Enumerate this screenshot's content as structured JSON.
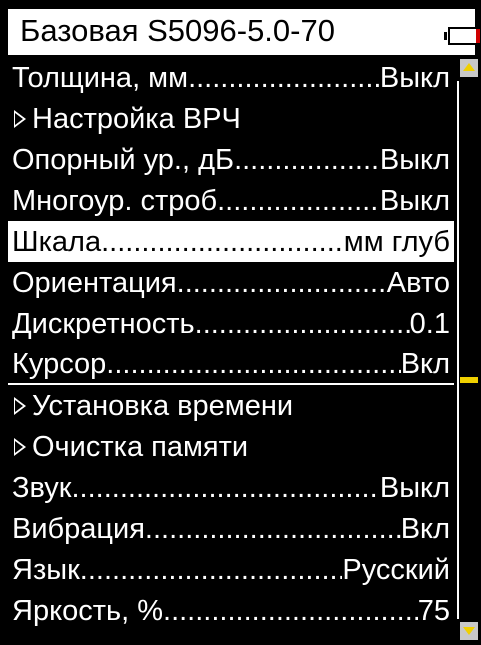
{
  "title": "Базовая S5096-5.0-70",
  "battery_icon": "battery-low-icon",
  "colors": {
    "background": "#000000",
    "text": "#ffffff",
    "selected_bg": "#ffffff",
    "selected_text": "#000000",
    "battery_level": "#d00000",
    "scroll_accent": "#f0d000"
  },
  "menu": {
    "items": [
      {
        "label": "Толщина, мм",
        "value": "Выкл"
      },
      {
        "label": "Настройка ВРЧ",
        "value": ""
      },
      {
        "label": "Опорный ур., дБ",
        "value": "Выкл"
      },
      {
        "label": "Многоур. строб",
        "value": "Выкл"
      },
      {
        "label": "Шкала",
        "value": "мм глуб"
      },
      {
        "label": "Ориентация",
        "value": "Авто"
      },
      {
        "label": "Дискретность",
        "value": "0.1"
      },
      {
        "label": "Курсор",
        "value": "Вкл"
      },
      {
        "label": "Установка времени",
        "value": ""
      },
      {
        "label": "Очистка памяти",
        "value": ""
      },
      {
        "label": "Звук",
        "value": "Выкл"
      },
      {
        "label": "Вибрация",
        "value": "Вкл"
      },
      {
        "label": "Язык",
        "value": "Русский"
      },
      {
        "label": "Яркость, %",
        "value": "75"
      }
    ],
    "selected_label": "Шкала"
  },
  "scrollbar": {
    "up_icon": "scroll-up-arrow-icon",
    "down_icon": "scroll-down-arrow-icon"
  }
}
